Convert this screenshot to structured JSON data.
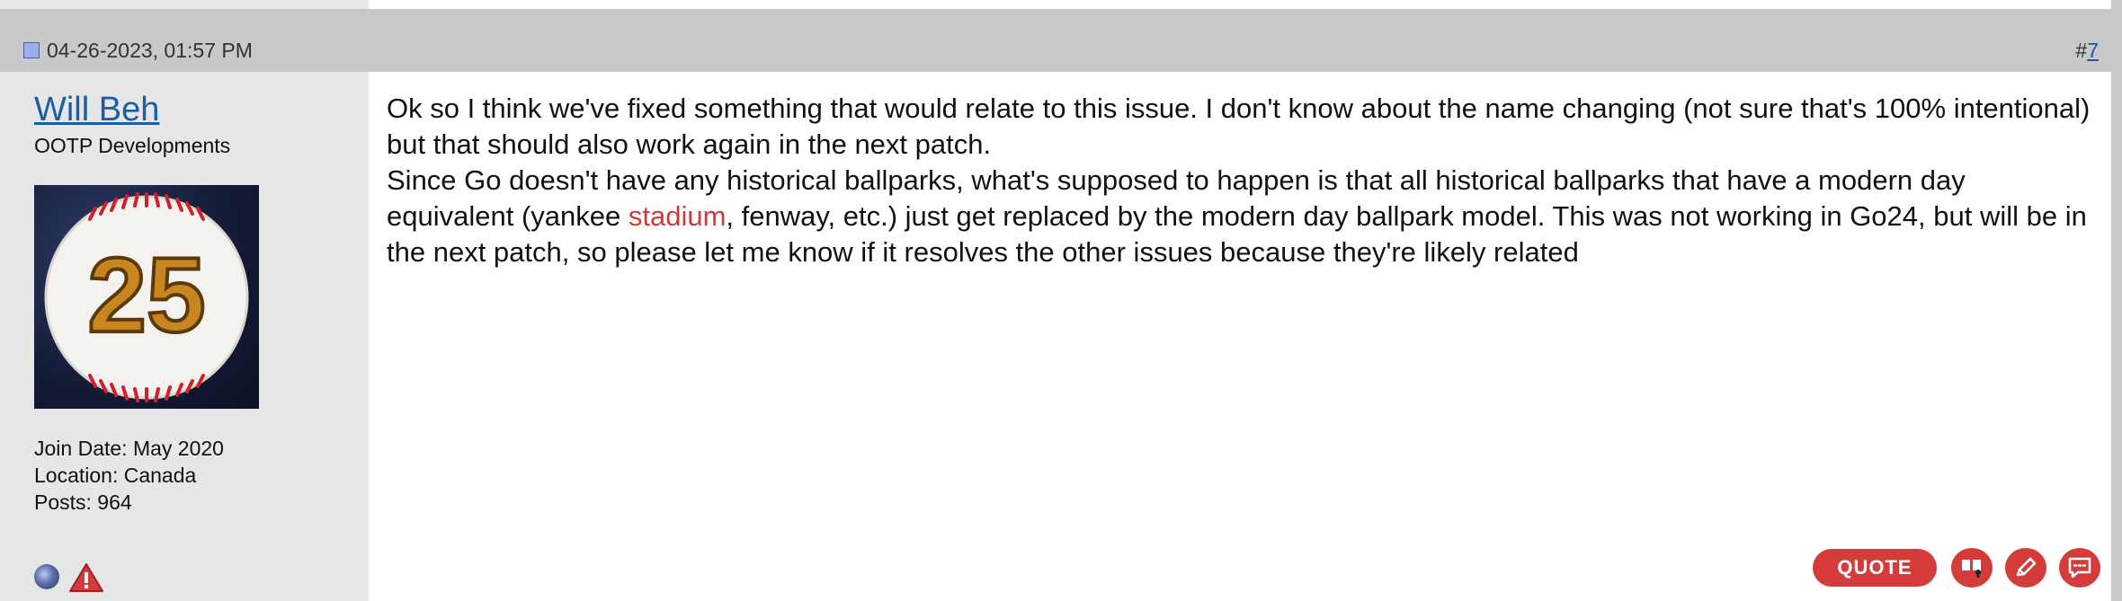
{
  "post": {
    "date": "04-26-2023, 01:57 PM",
    "number_prefix": "#",
    "number": "7"
  },
  "user": {
    "name": "Will Beh",
    "title": "OOTP Developments",
    "avatar_text": "25",
    "join_date": "Join Date: May 2020",
    "location": "Location: Canada",
    "posts": "Posts: 964"
  },
  "message": {
    "line1": "Ok so I think we've fixed something that would relate to this issue. I don't know about the name changing (not sure that's 100% intentional) but that should also work again in the next patch.",
    "line2_before": "Since Go doesn't have any historical ballparks, what's supposed to happen is that all historical ballparks that have a modern day equivalent (yankee ",
    "line2_keyword": "stadium",
    "line2_after": ", fenway, etc.) just get replaced by the modern day ballpark model. This was not working in Go24, but will be in the next patch, so please let me know if it resolves the other issues because they're likely related"
  },
  "actions": {
    "quote_label": "QUOTE"
  },
  "icons": {
    "post_icon": "post-icon",
    "online_status": "online-status-icon",
    "report": "report-warning-icon",
    "multiquote": "multiquote-icon",
    "edit": "edit-pencil-icon",
    "reply": "reply-bubble-icon"
  },
  "colors": {
    "accent_red": "#d43c3c",
    "link_blue": "#1a5fa6",
    "keyword_red": "#d23a3a"
  }
}
